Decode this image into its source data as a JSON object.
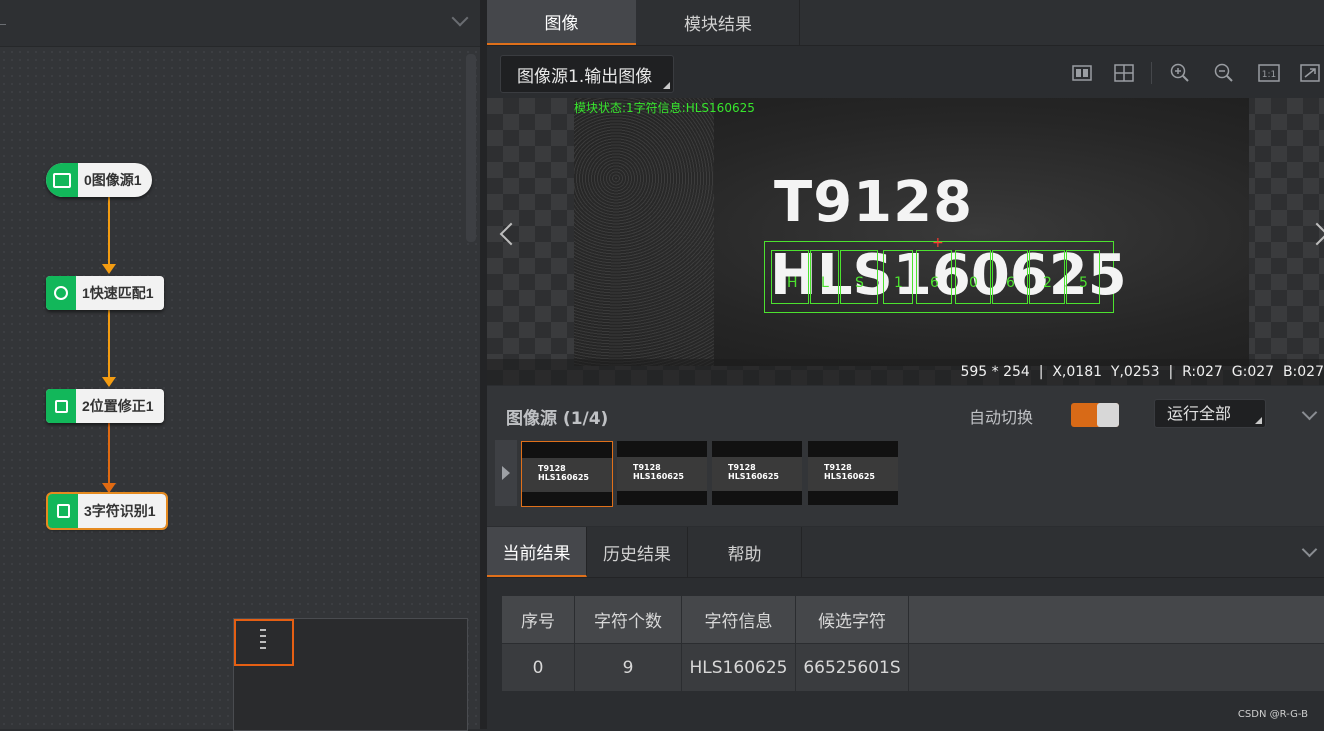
{
  "flow": {
    "nodes": [
      {
        "label": "0图像源1",
        "icon": "image-icon"
      },
      {
        "label": "1快速匹配1",
        "icon": "shape-match-icon"
      },
      {
        "label": "2位置修正1",
        "icon": "position-correct-icon"
      },
      {
        "label": "3字符识别1",
        "icon": "ocr-icon"
      }
    ]
  },
  "tabs_top": [
    {
      "label": "图像"
    },
    {
      "label": "模块结果"
    }
  ],
  "image_view": {
    "source_select": "图像源1.输出图像",
    "status_text": "模块状态:1字符信息:HLS160625",
    "text_line1": "T9128",
    "text_line2": "HLS160625",
    "char_labels": [
      "H",
      "L",
      "S",
      "1",
      "6",
      "0",
      "6",
      "2",
      "5"
    ],
    "info": {
      "size": "595 * 254",
      "x": "X,0181",
      "y": "Y,0253",
      "r": "R:027",
      "g": "G:027",
      "b": "B:027"
    },
    "toolbar_icons": [
      "split-view-icon",
      "grid-view-icon",
      "zoom-in-icon",
      "zoom-out-icon",
      "actual-size-icon",
      "fit-icon"
    ]
  },
  "image_source": {
    "title": "图像源 (1/4)",
    "auto_switch_label": "自动切换",
    "auto_switch_on": true,
    "run_all": "运行全部",
    "thumbnails": [
      {
        "line1": "T9128",
        "line2": "HLS160625"
      },
      {
        "line1": "T9128",
        "line2": "HLS160625"
      },
      {
        "line1": "T9128",
        "line2": "HLS160625"
      },
      {
        "line1": "T9128",
        "line2": "HLS160625"
      }
    ]
  },
  "tabs_bottom": [
    {
      "label": "当前结果"
    },
    {
      "label": "历史结果"
    },
    {
      "label": "帮助"
    }
  ],
  "results": {
    "headers": [
      "序号",
      "字符个数",
      "字符信息",
      "候选字符"
    ],
    "rows": [
      [
        "0",
        "9",
        "HLS160625",
        "66525601S"
      ]
    ]
  },
  "colors": {
    "accent": "#e0701a",
    "node_green": "#12b75a",
    "overlay_green": "#4ce22f"
  },
  "watermark": "CSDN @R-G-B"
}
